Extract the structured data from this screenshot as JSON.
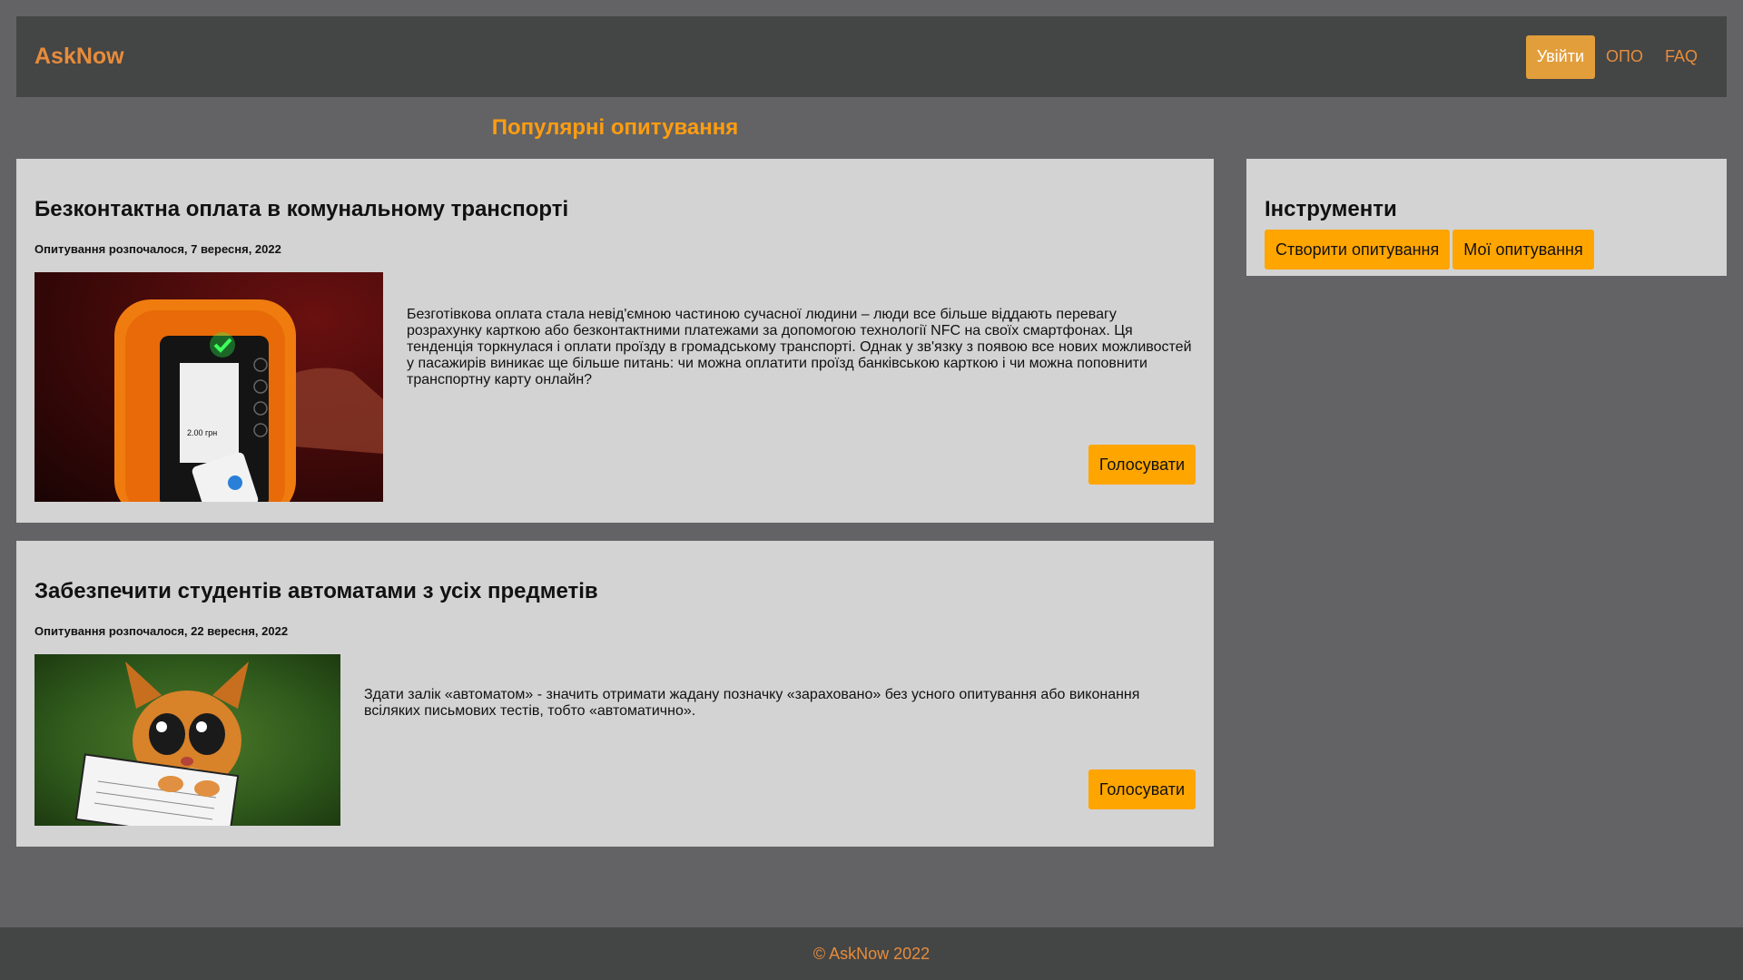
{
  "header": {
    "brand": "AskNow",
    "login_label": "Увійти",
    "links": [
      "ОПО",
      "FAQ"
    ]
  },
  "main": {
    "section_title": "Популярні опитування",
    "polls": [
      {
        "title": "Безконтактна оплата в комунальному транспорті",
        "date": "Опитування розпочалося, 7 вересня, 2022",
        "text": "Безготівкова оплата стала невід'ємною частиною сучасної людини – люди все більше віддають перевагу розрахунку карткою або безконтактними платежами за допомогою технології NFC на своїх смартфонах. Ця тенденція торкнулася і оплати проїзду в громадському транспорті. Однак у зв'язку з появою все нових можливостей у пасажирів виникає ще більше питань: чи можна оплатити проїзд банківською карткою і чи можна поповнити транспортну карту онлайн?",
        "vote_label": "Голосувати",
        "image_price": "2.00 грн"
      },
      {
        "title": "Забезпечити студентів автоматами з усіх предметів",
        "date": "Опитування розпочалося, 22 вересня, 2022",
        "text": "Здати залік «автоматом» - значить отримати жадану позначку «зараховано» без усного опитування або виконання всіляких письмових тестів, тобто «автоматично».",
        "vote_label": "Голосувати"
      }
    ]
  },
  "sidebar": {
    "title": "Інструменти",
    "buttons": [
      "Створити опитування",
      "Мої опитування"
    ]
  },
  "footer": {
    "text": "© AskNow 2022"
  },
  "colors": {
    "accent": "#ffa500",
    "brand": "#e68c3c",
    "nav_bg": "#444545",
    "page_bg": "#636365",
    "card_bg": "#d3d3d3"
  }
}
